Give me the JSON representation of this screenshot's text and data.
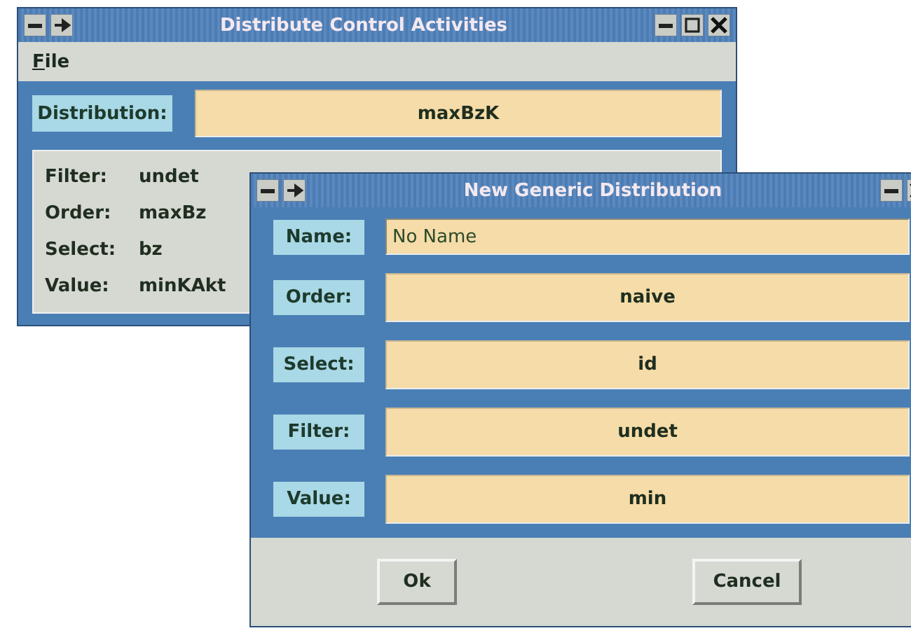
{
  "main_window": {
    "title": "Distribute Control Activities",
    "menu": [
      "File"
    ],
    "distribution": {
      "label": "Distribution:",
      "value": "maxBzK"
    },
    "properties": [
      {
        "label": "Filter:",
        "value": "undet"
      },
      {
        "label": "Order:",
        "value": "maxBz"
      },
      {
        "label": "Select:",
        "value": "bz"
      },
      {
        "label": "Value:",
        "value": "minKAkt"
      }
    ]
  },
  "dialog": {
    "title": "New Generic Distribution",
    "fields": [
      {
        "kind": "input",
        "label": "Name:",
        "value": "No Name"
      },
      {
        "kind": "choice",
        "label": "Order:",
        "value": "naive"
      },
      {
        "kind": "choice",
        "label": "Select:",
        "value": "id"
      },
      {
        "kind": "choice",
        "label": "Filter:",
        "value": "undet"
      },
      {
        "kind": "choice",
        "label": "Value:",
        "value": "min"
      }
    ],
    "buttons": [
      "Ok",
      "Cancel"
    ]
  }
}
